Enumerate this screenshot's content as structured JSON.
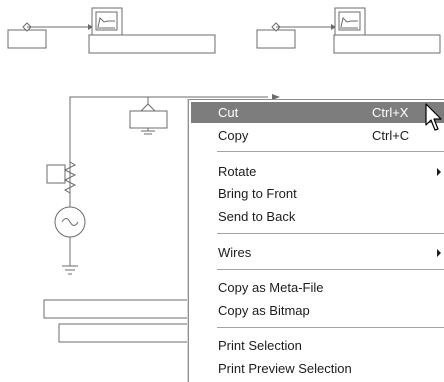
{
  "context_menu": {
    "items": [
      {
        "label": "Cut",
        "shortcut": "Ctrl+X",
        "highlighted": true
      },
      {
        "label": "Copy",
        "shortcut": "Ctrl+C"
      },
      {
        "label": "Rotate",
        "submenu": true
      },
      {
        "label": "Bring to Front"
      },
      {
        "label": "Send to Back"
      },
      {
        "label": "Wires",
        "submenu": true
      },
      {
        "label": "Copy as Meta-File"
      },
      {
        "label": "Copy as Bitmap"
      },
      {
        "label": "Print Selection"
      },
      {
        "label": "Print Preview Selection"
      }
    ]
  },
  "colors": {
    "highlight": "#7d7d7d",
    "schematic_line": "#6b6b6b"
  }
}
